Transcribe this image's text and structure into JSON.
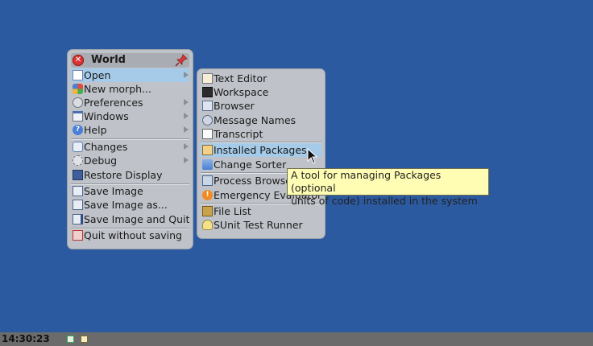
{
  "world_menu": {
    "title": "World",
    "items": [
      {
        "label": "Open",
        "icon": "open-icon",
        "submenu": true,
        "highlighted": true
      },
      {
        "label": "New morph...",
        "icon": "morph-icon",
        "submenu": false
      },
      {
        "label": "Preferences",
        "icon": "preferences-icon",
        "submenu": true
      },
      {
        "label": "Windows",
        "icon": "windows-icon",
        "submenu": true
      },
      {
        "label": "Help",
        "icon": "help-icon",
        "submenu": true
      },
      {
        "label": "Changes",
        "icon": "changes-icon",
        "submenu": true
      },
      {
        "label": "Debug",
        "icon": "debug-icon",
        "submenu": true
      },
      {
        "label": "Restore Display",
        "icon": "restore-display-icon",
        "submenu": false
      },
      {
        "label": "Save Image",
        "icon": "save-icon",
        "submenu": false
      },
      {
        "label": "Save Image as...",
        "icon": "save-as-icon",
        "submenu": false
      },
      {
        "label": "Save Image and Quit",
        "icon": "save-and-quit-icon",
        "submenu": false
      },
      {
        "label": "Quit without saving",
        "icon": "quit-icon",
        "submenu": false
      }
    ]
  },
  "open_menu": {
    "items": [
      {
        "label": "Text Editor",
        "icon": "text-editor-icon"
      },
      {
        "label": "Workspace",
        "icon": "workspace-icon"
      },
      {
        "label": "Browser",
        "icon": "browser-icon"
      },
      {
        "label": "Message Names",
        "icon": "message-names-icon"
      },
      {
        "label": "Transcript",
        "icon": "transcript-icon"
      },
      {
        "label": "Installed Packages",
        "icon": "packages-icon",
        "highlighted": true
      },
      {
        "label": "Change Sorter",
        "icon": "change-sorter-icon"
      },
      {
        "label": "Process Browser",
        "icon": "process-browser-icon"
      },
      {
        "label": "Emergency Evaluator",
        "icon": "emergency-icon"
      },
      {
        "label": "File List",
        "icon": "file-list-icon"
      },
      {
        "label": "SUnit Test Runner",
        "icon": "sunit-icon"
      }
    ]
  },
  "tooltip": {
    "line1": "A tool for managing Packages (optional",
    "line2": "units of code) installed in the system"
  },
  "taskbar": {
    "clock": "14:30:23"
  },
  "colors": {
    "desktop": "#2c5aa0",
    "menu_bg": "#bfc3c9",
    "highlight": "#a6cbe9",
    "tooltip_bg": "#fffdb3"
  }
}
